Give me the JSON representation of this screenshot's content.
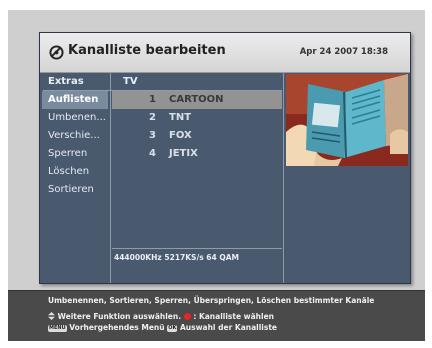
{
  "header": {
    "title": "Kanalliste bearbeiten",
    "datetime": "Apr 24 2007 18:38"
  },
  "columns": {
    "extras": "Extras",
    "tv": "TV"
  },
  "menu": {
    "items": [
      {
        "label": "Auflisten"
      },
      {
        "label": "Umbenen..."
      },
      {
        "label": "Verschie..."
      },
      {
        "label": "Sperren"
      },
      {
        "label": "Löschen"
      },
      {
        "label": "Sortieren"
      }
    ],
    "active_index": 0
  },
  "channels": [
    {
      "number": "1",
      "name": "CARTOON"
    },
    {
      "number": "2",
      "name": "TNT"
    },
    {
      "number": "3",
      "name": "FOX"
    },
    {
      "number": "4",
      "name": "JETIX"
    }
  ],
  "selected_channel_index": 0,
  "status": "444000KHz 5217KS/s 64 QAM",
  "info": {
    "description": "Umbenennen, Sortieren, Sperren, Überspringen, Löschen bestimmter Kanäle",
    "line1_text_a": "Weitere Funktion auswählen.",
    "line1_text_b": ": Kanalliste wählen",
    "line2_badge_menu": "MENU",
    "line2_text_a": "Vorhergehendes Menü",
    "line2_badge_ok": "OK",
    "line2_text_b": "Auswahl der Kanalliste"
  },
  "colors": {
    "panel": "#4a5a6e",
    "selection": "#939393",
    "title_bar": "#e0e0e0",
    "info_bar": "#4a4a4a",
    "red_button": "#e22222"
  },
  "icons": {
    "title": "satellite-dish-icon",
    "updown": "up-down-arrows-icon",
    "red": "red-button-icon"
  }
}
